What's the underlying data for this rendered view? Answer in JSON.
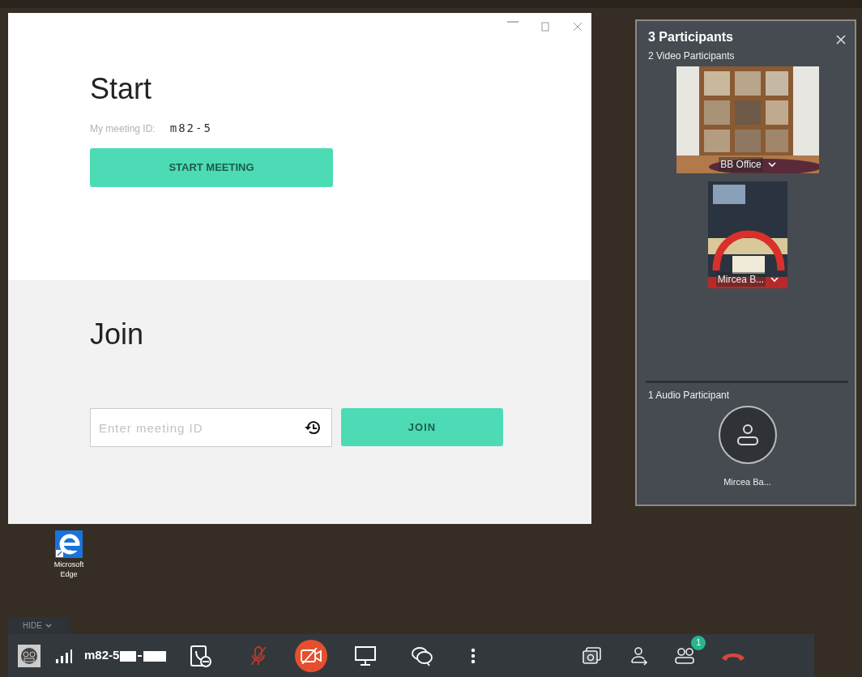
{
  "app_window": {
    "start": {
      "title": "Start",
      "meeting_id_label": "My meeting ID:",
      "meeting_id": "m82-5",
      "button": "START MEETING"
    },
    "join": {
      "title": "Join",
      "placeholder": "Enter meeting ID",
      "button": "JOIN"
    }
  },
  "participants_panel": {
    "title": "3 Participants",
    "video_heading": "2 Video Participants",
    "video_participants": [
      {
        "name": "BB Office",
        "kind": "picture"
      },
      {
        "name": "Mircea B...",
        "kind": "picture"
      }
    ],
    "audio_heading": "1 Audio Participant",
    "audio_participants": [
      {
        "name": "Mircea Ba..."
      }
    ]
  },
  "desktop_icons": [
    {
      "label": "Microsoft Edge"
    }
  ],
  "toolbar": {
    "hide_label": "HIDE",
    "meeting_id": "m82-5",
    "microphone_muted": true,
    "video_off": true,
    "participants_badge": "1"
  }
}
